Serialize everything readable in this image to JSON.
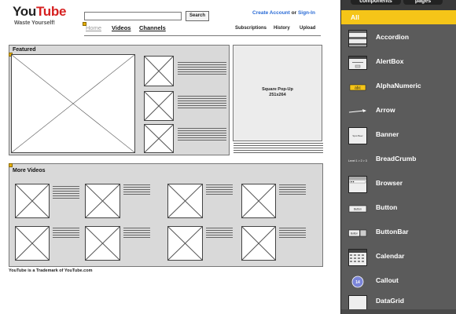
{
  "header": {
    "logo_you": "You",
    "logo_tube": "Tube",
    "tagline": "Waste Yourself!",
    "search_button": "Search",
    "create_account": "Create Account",
    "or": "or",
    "sign_in": "Sign-In"
  },
  "nav": {
    "home": "Home",
    "videos": "Videos",
    "channels": "Channels",
    "subscriptions": "Subscriptions",
    "history": "History",
    "upload": "Upload"
  },
  "featured": {
    "title": "Featured"
  },
  "popup": {
    "line1": "Square Pop-Up",
    "line2": "251x264"
  },
  "more_videos": {
    "title": "More Videos"
  },
  "footer": {
    "note": "YouTube is a Trademark of YouTube.com"
  },
  "palette": {
    "tab_components": "components",
    "tab_pages": "pages",
    "filter_all": "All",
    "items": [
      {
        "label": "Accordion",
        "icon": "accordion-icon"
      },
      {
        "label": "AlertBox",
        "icon": "alertbox-icon"
      },
      {
        "label": "AlphaNumeric",
        "icon": "alphanumeric-icon"
      },
      {
        "label": "Arrow",
        "icon": "arrow-icon"
      },
      {
        "label": "Banner",
        "icon": "banner-icon"
      },
      {
        "label": "BreadCrumb",
        "icon": "breadcrumb-icon"
      },
      {
        "label": "Browser",
        "icon": "browser-icon"
      },
      {
        "label": "Button",
        "icon": "button-icon"
      },
      {
        "label": "ButtonBar",
        "icon": "buttonbar-icon"
      },
      {
        "label": "Calendar",
        "icon": "calendar-icon"
      },
      {
        "label": "Callout",
        "icon": "callout-icon"
      },
      {
        "label": "DataGrid",
        "icon": "datagrid-icon"
      }
    ],
    "icon_text": {
      "alpha": "abc",
      "banner": "Spot Beer",
      "breadcrumb": "Level 1 > 2 > 3",
      "button": "Button",
      "buttonbar": "Button",
      "callout": "14"
    }
  },
  "colors": {
    "accent": "#f5c518",
    "link": "#2a6bd6",
    "logo_red": "#d62020"
  }
}
